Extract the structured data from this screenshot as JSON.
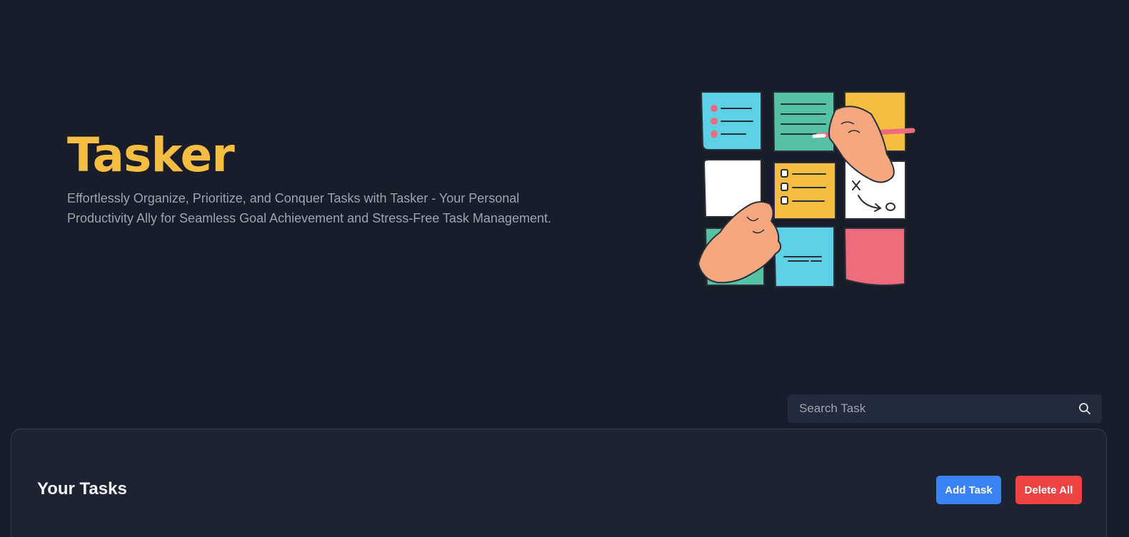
{
  "hero": {
    "title": "Tasker",
    "subtitle": "Effortlessly Organize, Prioritize, and Conquer Tasks with Tasker - Your Personal Productivity Ally for Seamless Goal Achievement and Stress-Free Task Management.",
    "illustration_icon": "sticky-notes-illustration"
  },
  "search": {
    "placeholder": "Search Task",
    "value": "",
    "icon": "search-icon"
  },
  "tasks": {
    "heading": "Your Tasks",
    "add_label": "Add Task",
    "delete_all_label": "Delete All"
  },
  "colors": {
    "background": "#191d29",
    "brand": "#f5bd41",
    "add_button": "#3b82f6",
    "delete_button": "#ef4444"
  }
}
